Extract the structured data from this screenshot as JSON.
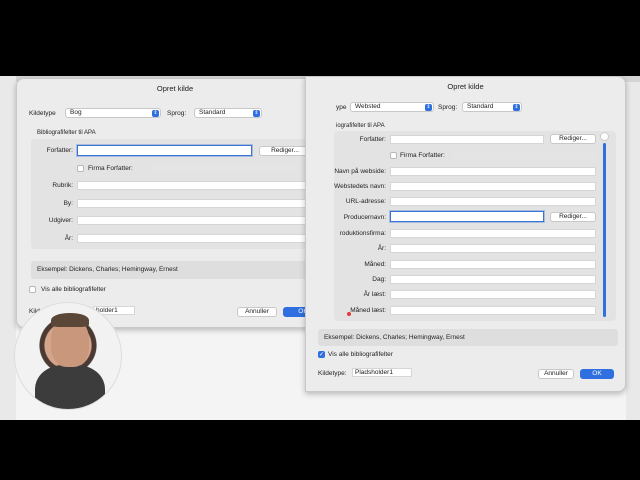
{
  "left_dialog": {
    "title": "Opret kilde",
    "kildetype_label": "Kildetype",
    "kildetype_value": "Bog",
    "sprog_label": "Sprog:",
    "sprog_value": "Standard",
    "group_title": "Bibliografifelter til APA",
    "forfatter_label": "Forfatter:",
    "rediger_label": "Rediger...",
    "firma_label": "Firma Forfatter:",
    "fields": [
      "Rubrik:",
      "By:",
      "Udgiver:",
      "År:"
    ],
    "example": "Eksempel: Dickens, Charles; Hemingway, Ernest",
    "vis_alle": "Vis alle bibliografifelter",
    "bottom_label": "Kilde",
    "bottom_value": "holder1",
    "cancel": "Annuller",
    "ok": "OK"
  },
  "right_dialog": {
    "title": "Opret kilde",
    "kildetype_label": "ype",
    "kildetype_value": "Websted",
    "sprog_label": "Sprog:",
    "sprog_value": "Standard",
    "group_title": "iografifelter til APA",
    "forfatter_label": "Forfatter:",
    "rediger_label": "Rediger...",
    "firma_label": "Firma Forfatter:",
    "fields": [
      "Navn på webside:",
      "Webstedets navn:",
      "URL-adresse:"
    ],
    "producer_label": "Producernavn:",
    "producer_rediger": "Rediger...",
    "fields2": [
      "roduktionsfirma:",
      "År:",
      "Måned:",
      "Dag:",
      "År læst:",
      "Måned læst:"
    ],
    "example": "Eksempel: Dickens, Charles; Hemingway, Ernest",
    "vis_alle": "Vis alle bibliografifelter",
    "kildetype_bottom_label": "Kildetype:",
    "kildetype_bottom_value": "Pladsholder1",
    "cancel": "Annuller",
    "ok": "OK"
  },
  "colors": {
    "accent": "#2f6fe0"
  }
}
